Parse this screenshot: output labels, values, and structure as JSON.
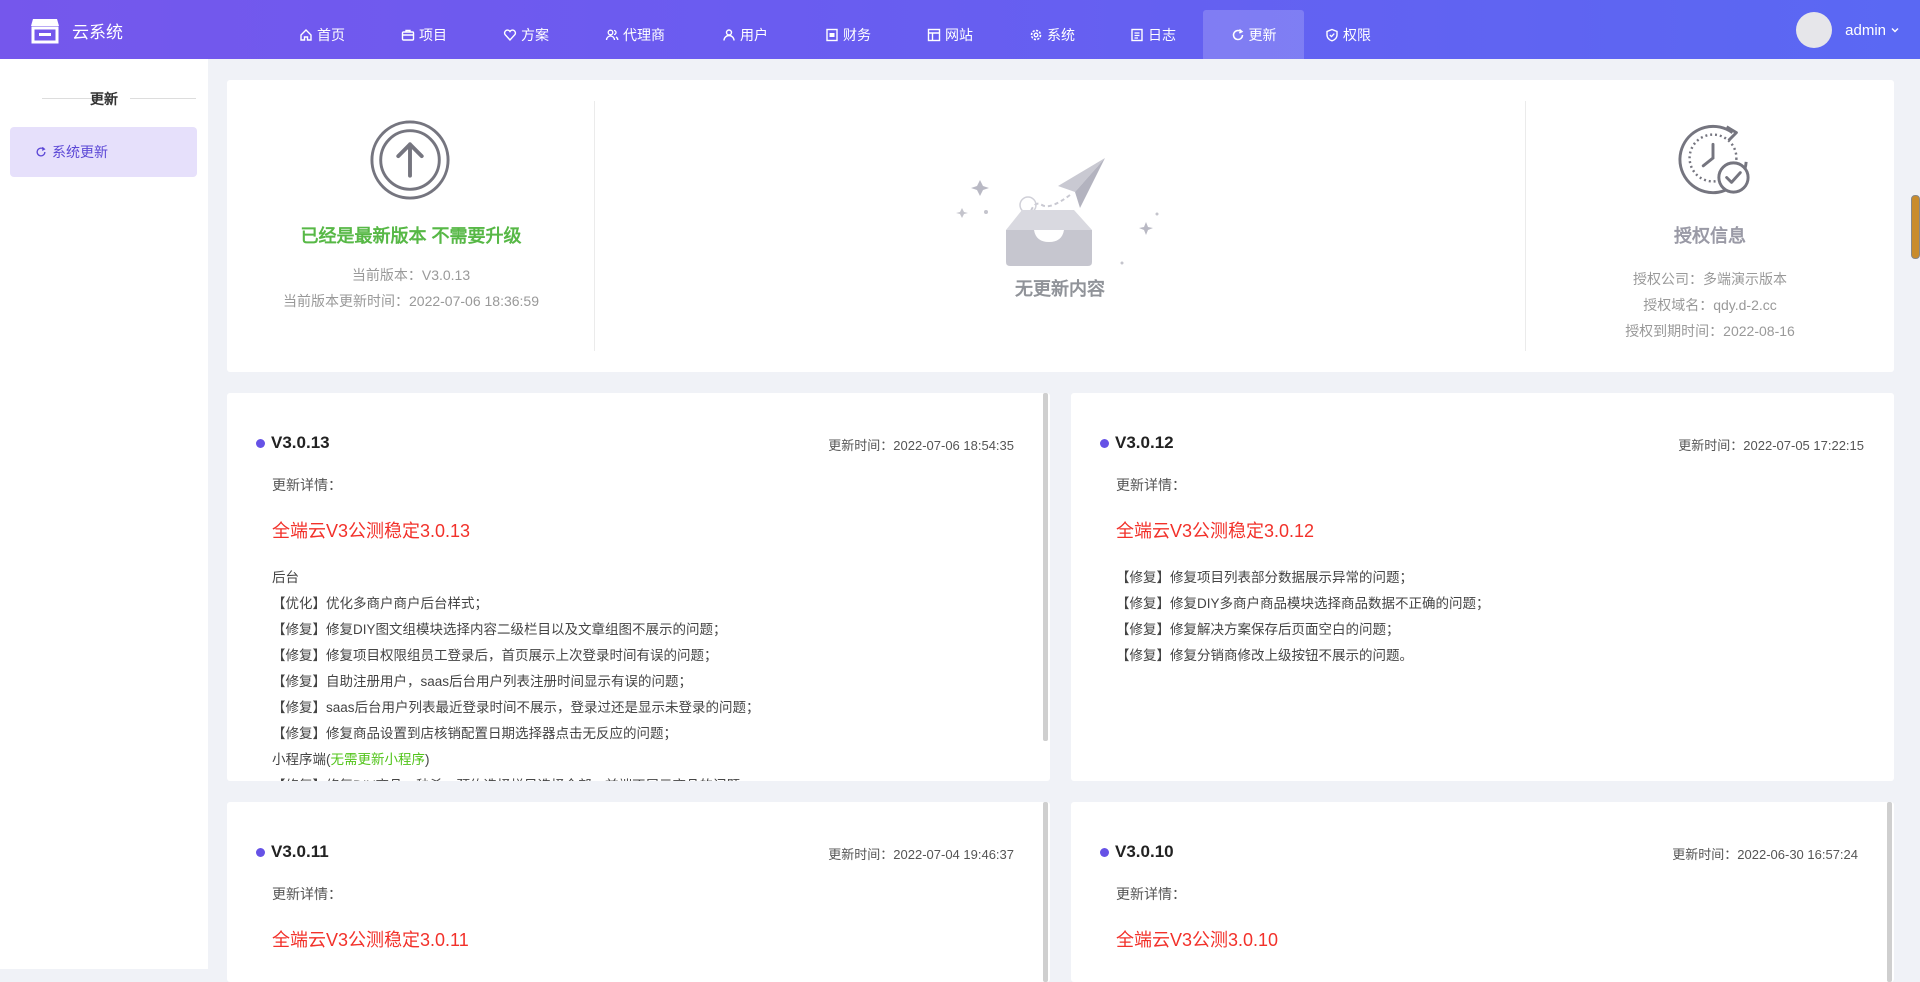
{
  "app": {
    "name": "云系统"
  },
  "nav": [
    {
      "label": "首页",
      "icon": "home-icon"
    },
    {
      "label": "项目",
      "icon": "briefcase-icon"
    },
    {
      "label": "方案",
      "icon": "heart-icon"
    },
    {
      "label": "代理商",
      "icon": "users-icon"
    },
    {
      "label": "用户",
      "icon": "user-icon"
    },
    {
      "label": "财务",
      "icon": "finance-icon"
    },
    {
      "label": "网站",
      "icon": "website-icon"
    },
    {
      "label": "系统",
      "icon": "gear-icon"
    },
    {
      "label": "日志",
      "icon": "log-icon"
    },
    {
      "label": "更新",
      "icon": "refresh-icon",
      "active": true
    },
    {
      "label": "权限",
      "icon": "shield-icon"
    }
  ],
  "user": {
    "name": "admin"
  },
  "sidebar": {
    "title": "更新",
    "items": [
      {
        "label": "系统更新",
        "active": true
      }
    ]
  },
  "summary": {
    "status": "已经是最新版本 不需要升级",
    "current_version": "当前版本：V3.0.13",
    "current_time": "当前版本更新时间：2022-07-06 18:36:59",
    "empty_text": "无更新内容",
    "license_title": "授权信息",
    "license_company": "授权公司：多端演示版本",
    "license_domain": "授权域名：qdy.d-2.cc",
    "license_expire": "授权到期时间：2022-08-16"
  },
  "versions": [
    {
      "version": "V3.0.13",
      "time": "更新时间：2022-07-06 18:54:35",
      "detail_label": "更新详情：",
      "title": "全端云V3公测稳定3.0.13",
      "lines": [
        "后台",
        "【优化】优化多商户商户后台样式；",
        "【修复】修复DIY图文组模块选择内容二级栏目以及文章组图不展示的问题；",
        "【修复】修复项目权限组员工登录后，首页展示上次登录时间有误的问题；",
        "【修复】自助注册用户，saas后台用户列表注册时间显示有误的问题；",
        "【修复】saas后台用户列表最近登录时间不展示，登录过还是显示未登录的问题；",
        "【修复】修复商品设置到店核销配置日期选择器点击无反应的问题；"
      ],
      "mini_prefix": "小程序端(",
      "mini_green": "无需更新小程序",
      "mini_suffix": ")",
      "cut_line": "【修复】修复DIY商品、秒杀、预约选择栏目选择全部，前端不展示商品的问题；"
    },
    {
      "version": "V3.0.12",
      "time": "更新时间：2022-07-05 17:22:15",
      "detail_label": "更新详情：",
      "title": "全端云V3公测稳定3.0.12",
      "lines": [
        "【修复】修复项目列表部分数据展示异常的问题；",
        "【修复】修复DIY多商户商品模块选择商品数据不正确的问题；",
        "【修复】修复解决方案保存后页面空白的问题；",
        "【修复】修复分销商修改上级按钮不展示的问题。"
      ]
    },
    {
      "version": "V3.0.11",
      "time": "更新时间：2022-07-04 19:46:37",
      "detail_label": "更新详情：",
      "title": "全端云V3公测稳定3.0.11"
    },
    {
      "version": "V3.0.10",
      "time": "更新时间：2022-06-30 16:57:24",
      "detail_label": "更新详情：",
      "title": "全端云V3公测3.0.10"
    }
  ]
}
